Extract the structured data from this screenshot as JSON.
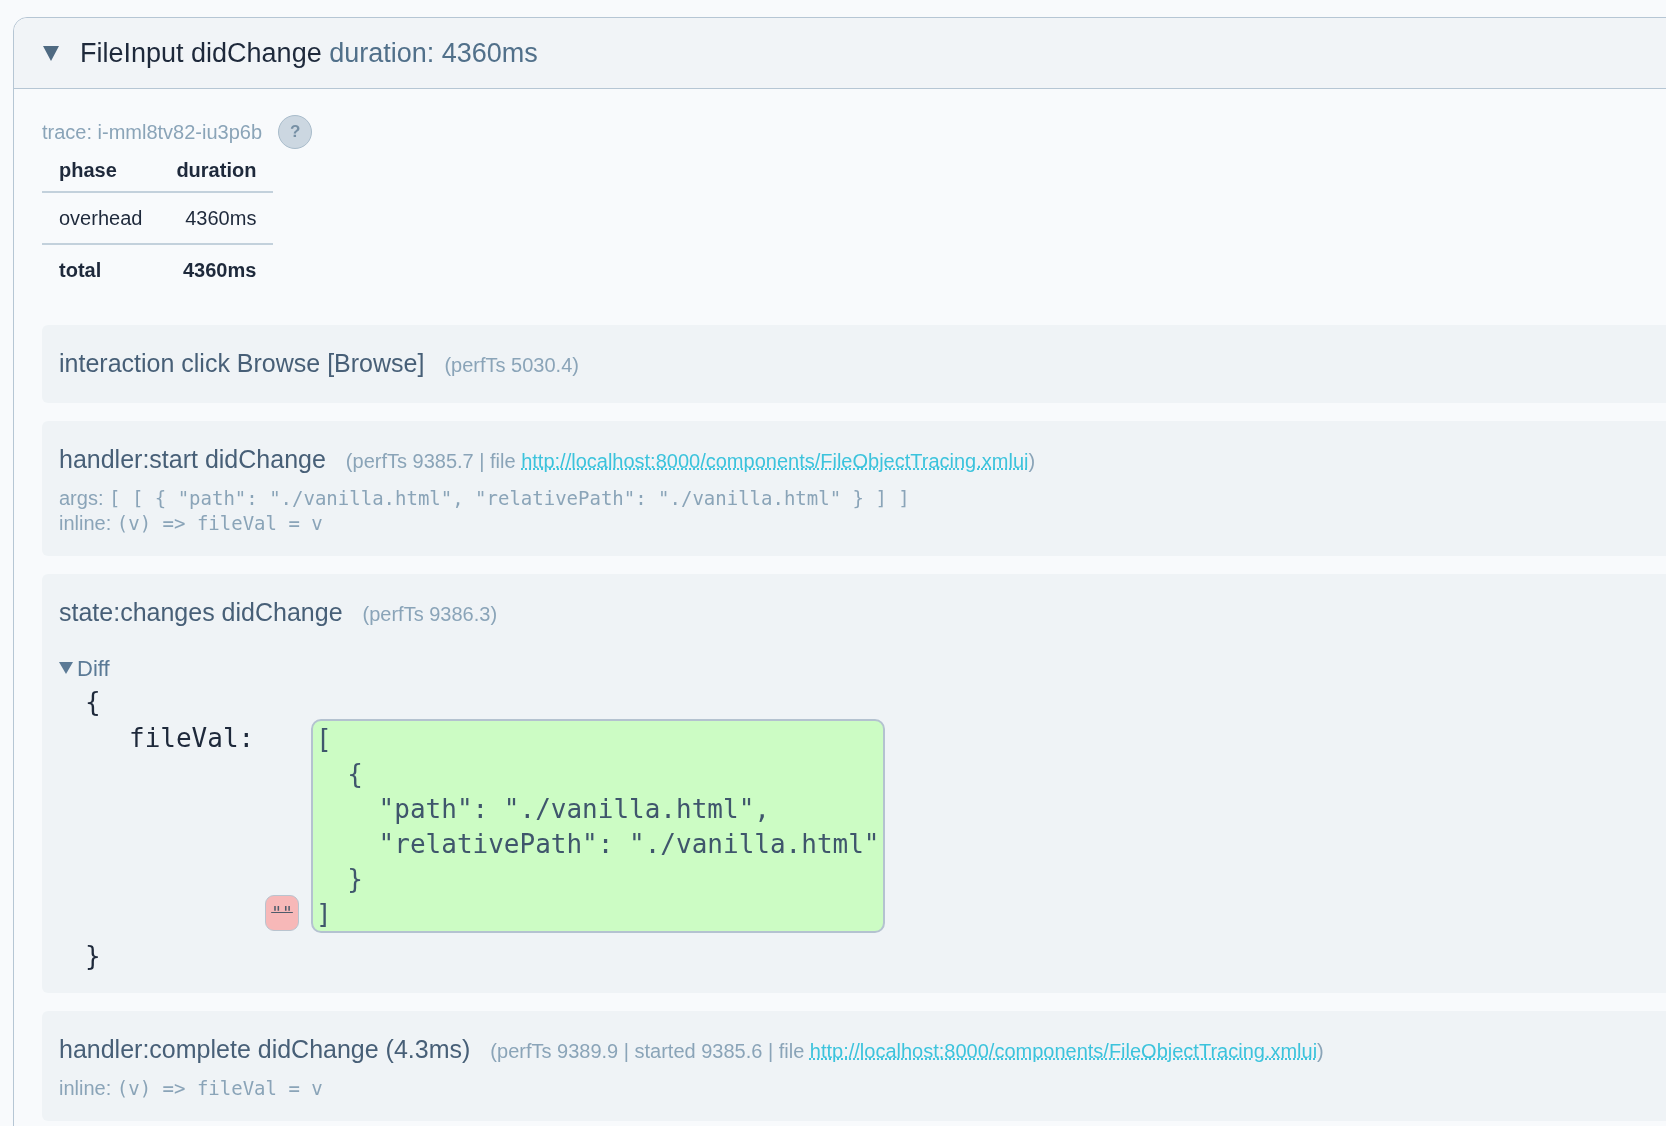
{
  "panel": {
    "expanded": true,
    "title": "FileInput didChange",
    "duration": "duration: 4360ms"
  },
  "trace": {
    "label": "trace: i-mml8tv82-iu3p6b",
    "help": "?"
  },
  "phase_table": {
    "columns": [
      "phase",
      "duration"
    ],
    "rows": [
      {
        "kind": "normal",
        "cells": [
          "overhead",
          "4360ms"
        ]
      },
      {
        "kind": "total",
        "cells": [
          "total",
          "4360ms"
        ]
      }
    ]
  },
  "events": [
    {
      "kind": "plain",
      "title": "interaction click Browse [Browse]",
      "meta": "(perfTs 5030.4)"
    },
    {
      "kind": "handler",
      "title": "handler:start didChange",
      "meta_prefix": "(perfTs 9385.7 | file ",
      "link": "http://localhost:8000/components/FileObjectTracing.xmlui",
      "meta_suffix": ")",
      "lines": [
        {
          "label": "args: ",
          "code": "[ [ { \"path\": \"./vanilla.html\", \"relativePath\": \"./vanilla.html\" } ] ]"
        },
        {
          "label": "inline: ",
          "code": "(v) => fileVal = v"
        }
      ]
    },
    {
      "kind": "diff",
      "title": "state:changes didChange",
      "meta": "(perfTs 9386.3)",
      "diff": {
        "expanded": true,
        "label": "Diff",
        "open": "{",
        "close": "}",
        "key": "fileVal:",
        "removed": "\"\"",
        "added": [
          "[",
          "  {",
          "    \"path\": \"./vanilla.html\",",
          "    \"relativePath\": \"./vanilla.html\"",
          "  }",
          "]"
        ]
      }
    },
    {
      "kind": "handler",
      "title": "handler:complete didChange (4.3ms)",
      "meta_prefix": "(perfTs 9389.9 | started 9385.6 | file ",
      "link": "http://localhost:8000/components/FileObjectTracing.xmlui",
      "meta_suffix": ")",
      "lines": [
        {
          "label": "inline: ",
          "code": "(v) => fileVal = v"
        }
      ]
    }
  ]
}
